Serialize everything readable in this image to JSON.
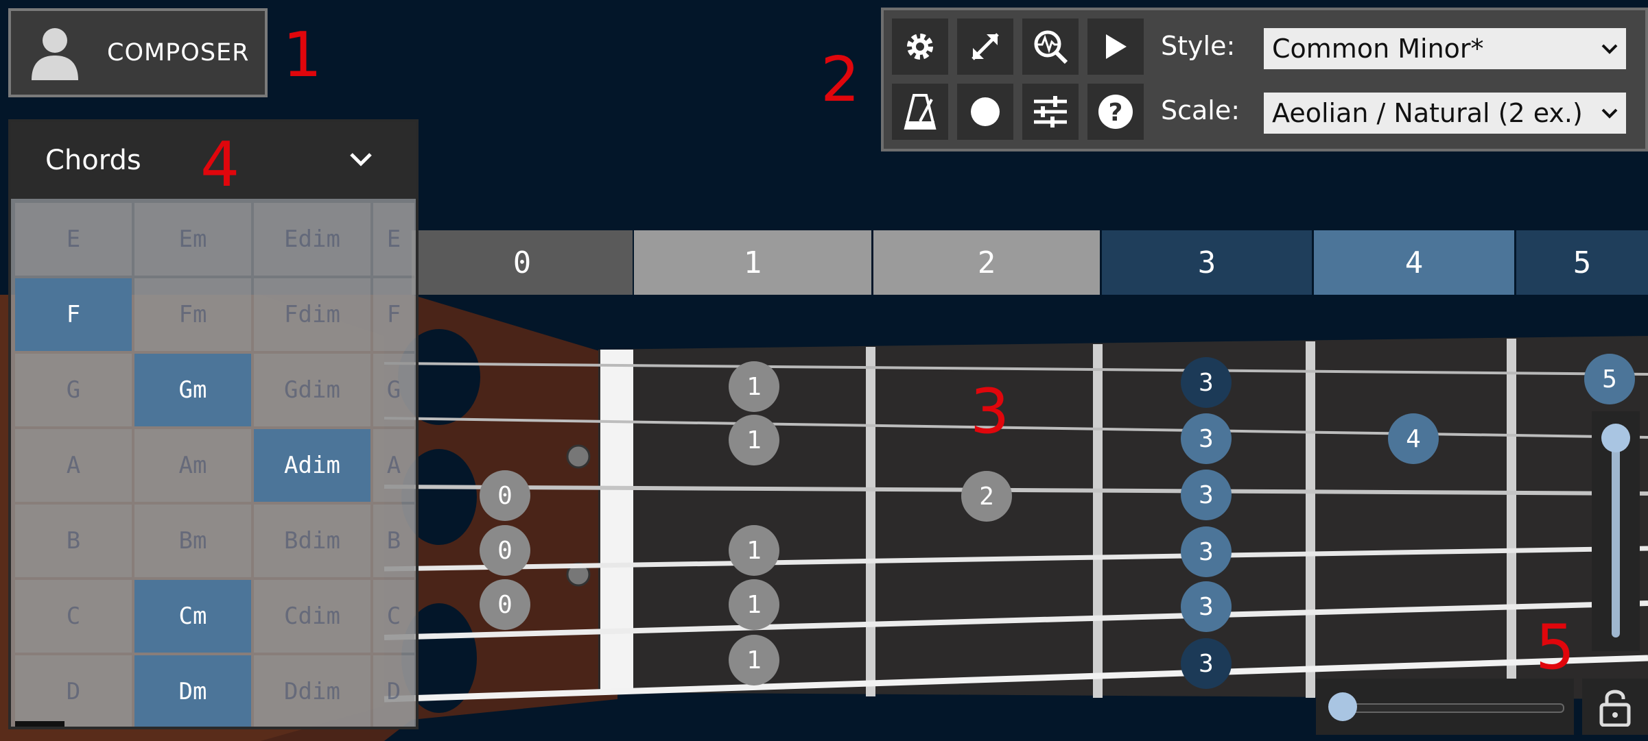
{
  "composer": {
    "label": "COMPOSER",
    "icon": "user-icon"
  },
  "annotations": [
    "1",
    "2",
    "3",
    "4",
    "5"
  ],
  "toolbar": {
    "buttons_row1": [
      "settings-icon",
      "expand-icon",
      "search-wave-icon",
      "play-icon"
    ],
    "buttons_row2": [
      "metronome-icon",
      "record-icon",
      "mixer-icon",
      "help-icon"
    ],
    "style_label": "Style:",
    "style_value": "Common Minor*",
    "scale_label": "Scale:",
    "scale_value": "Aeolian / Natural (2 ex.)"
  },
  "fret_header": [
    "0",
    "1",
    "2",
    "3",
    "4",
    "5"
  ],
  "notes": {
    "fret0": [
      "0",
      "0",
      "0"
    ],
    "fret1": [
      "1",
      "1",
      "1",
      "1",
      "1"
    ],
    "fret2": [
      "2"
    ],
    "fret3": [
      "3",
      "3",
      "3",
      "3",
      "3",
      "3"
    ],
    "fret4": [
      "4"
    ],
    "fret5": [
      "5"
    ]
  },
  "chords": {
    "title": "Chords",
    "rows": [
      [
        "E",
        "Em",
        "Edim",
        "E"
      ],
      [
        "F",
        "Fm",
        "Fdim",
        "F"
      ],
      [
        "G",
        "Gm",
        "Gdim",
        "G"
      ],
      [
        "A",
        "Am",
        "Adim",
        "A"
      ],
      [
        "B",
        "Bm",
        "Bdim",
        "B"
      ],
      [
        "C",
        "Cm",
        "Cdim",
        "C"
      ],
      [
        "D",
        "Dm",
        "Ddim",
        "D"
      ]
    ],
    "highlighted": [
      "F",
      "Gm",
      "Adim",
      "Cm",
      "Dm"
    ]
  },
  "colors": {
    "background": "#031629",
    "highlight_blue": "#4c7599",
    "dark_blue_note": "#1c3a57",
    "annotation_red": "#e0060c"
  }
}
